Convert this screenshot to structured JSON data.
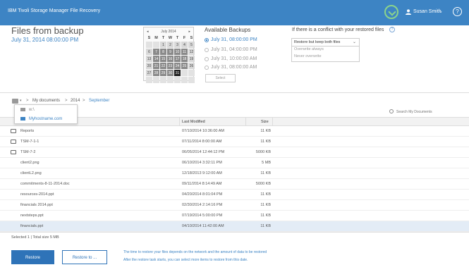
{
  "header": {
    "app_title": "IBM Tivoli Storage Manager File Recovery",
    "user_name": "Susan Smith",
    "caret": "⌄",
    "help_glyph": "?"
  },
  "summary": {
    "title": "Files from backup",
    "date": "July 31, 2014 08:00:00 PM"
  },
  "calendar": {
    "month": "July 2014",
    "prev": "◂",
    "next": "▸",
    "weekdays": [
      "S",
      "M",
      "T",
      "W",
      "T",
      "F",
      "S"
    ],
    "rows": [
      [
        "",
        "",
        "1",
        "2",
        "3",
        "4",
        "5"
      ],
      [
        "6",
        "7",
        "8",
        "9",
        "10",
        "11",
        "12"
      ],
      [
        "13",
        "14",
        "15",
        "16",
        "17",
        "18",
        "19"
      ],
      [
        "20",
        "21",
        "22",
        "23",
        "24",
        "25",
        "26"
      ],
      [
        "27",
        "28",
        "29",
        "30",
        "31",
        "",
        ""
      ],
      [
        "",
        "",
        "",
        "",
        "",
        "",
        ""
      ]
    ]
  },
  "backups": {
    "title": "Available Backups",
    "options": [
      "July 31, 08:00:00 PM",
      "July 31, 04:00:00 PM",
      "July 31, 10:00:00 AM",
      "July 31, 08:00:00 AM"
    ],
    "select_label": "Select"
  },
  "conflict": {
    "title": "If there is a conflict with your restored files",
    "selected": "Restore but keep both files",
    "options": [
      "Overwrite always",
      "Never overwrite"
    ]
  },
  "breadcrumb": {
    "items": [
      "My documents",
      "2014",
      "September"
    ],
    "separator": ">"
  },
  "host_popup": {
    "items": [
      "w:\\",
      "Myhostname.com"
    ]
  },
  "search": {
    "placeholder": "Search My Documents"
  },
  "table": {
    "headers": {
      "modified": "Last Modified",
      "size": "Size"
    },
    "rows": [
      {
        "name": "Reports",
        "modified": "07/10/2014 10:36:00 AM",
        "size": "11 KB",
        "folder": true
      },
      {
        "name": "TSM-7-1-1",
        "modified": "07/11/2014 8:00:00 AM",
        "size": "11 KB",
        "folder": true
      },
      {
        "name": "TSM-7-2",
        "modified": "06/05/2014 12:44:12 PM",
        "size": "5000 KB",
        "folder": true
      },
      {
        "name": "client2.png",
        "modified": "06/10/2014 3:32:11 PM",
        "size": "5 MB",
        "folder": false
      },
      {
        "name": "clientL2.png",
        "modified": "12/18/2013 9:12:00 AM",
        "size": "11 KB",
        "folder": false
      },
      {
        "name": "commitments-8-11-2014.doc",
        "modified": "09/11/2014 8:14:49 AM",
        "size": "5000 KB",
        "folder": false
      },
      {
        "name": "resources-2014.ppt",
        "modified": "04/20/2014 8:01:04 PM",
        "size": "11 KB",
        "folder": false
      },
      {
        "name": "financials 2014.ppt",
        "modified": "02/30/2014 2:14:16 PM",
        "size": "11 KB",
        "folder": false
      },
      {
        "name": "nextsteps.ppt",
        "modified": "07/19/2014 5:00:00 PM",
        "size": "11 KB",
        "folder": false
      },
      {
        "name": "financials.ppt",
        "modified": "04/10/2014 11:42:00 AM",
        "size": "11 KB",
        "folder": false
      }
    ]
  },
  "status": {
    "text": "Selected 1 | Total size 5 MB"
  },
  "footer": {
    "restore_label": "Restore",
    "restore_to_label": "Restore to ...",
    "note_line1": "The time to restore your files depends on the network and the amount of data to be restored",
    "note_line2": "After the restore task starts, you can select more items to restore from this date."
  }
}
